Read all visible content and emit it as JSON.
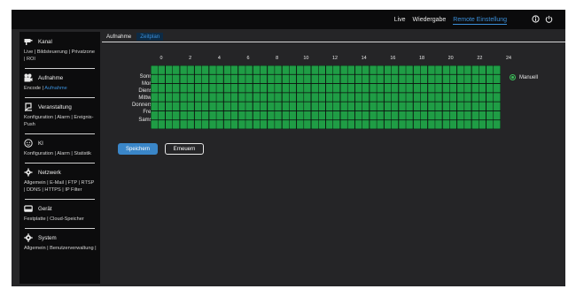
{
  "topnav": {
    "items": [
      "Live",
      "Wiedergabe",
      "Remote Einstellung"
    ],
    "active": "Remote Einstellung"
  },
  "sidebar": {
    "sections": [
      {
        "title": "Kanal",
        "icon": "camera-icon",
        "links": [
          "Live | Bildsteuerung | Privatzone | ROI"
        ]
      },
      {
        "title": "Aufnahme",
        "icon": "recording-icon",
        "links": [
          "Encode | ",
          "Aufnahme"
        ]
      },
      {
        "title": "Veranstaltung",
        "icon": "event-icon",
        "links": [
          "Konfiguration | Alarm | Ereignis-Push"
        ]
      },
      {
        "title": "KI",
        "icon": "ai-face-icon",
        "links": [
          "Konfiguration | Alarm | Statistik"
        ]
      },
      {
        "title": "Netzwerk",
        "icon": "network-gear-icon",
        "links": [
          "Allgemein | E-Mail | FTP | RTSP | DDNS | HTTPS | IP Filter"
        ]
      },
      {
        "title": "Gerät",
        "icon": "hdd-device-icon",
        "links": [
          "Festplatte | Cloud-Speicher"
        ]
      },
      {
        "title": "System",
        "icon": "system-gear-icon",
        "links": [
          "Allgemein | Benutzerverwaltung |"
        ]
      }
    ]
  },
  "tabs": [
    "Aufnahme",
    "Zeitplan"
  ],
  "active_tab": "Zeitplan",
  "schedule": {
    "hour_labels": [
      "0",
      "2",
      "4",
      "6",
      "8",
      "10",
      "12",
      "14",
      "16",
      "18",
      "20",
      "22",
      "24"
    ],
    "days": [
      "Sonntag",
      "Montag",
      "Dienstag",
      "Mittwoch",
      "Donnerstag",
      "Freitag",
      "Samstag"
    ],
    "mode_label": "Manuell",
    "fill_color": "#1f9d45"
  },
  "buttons": {
    "save": "Speichern",
    "refresh": "Erneuern"
  }
}
